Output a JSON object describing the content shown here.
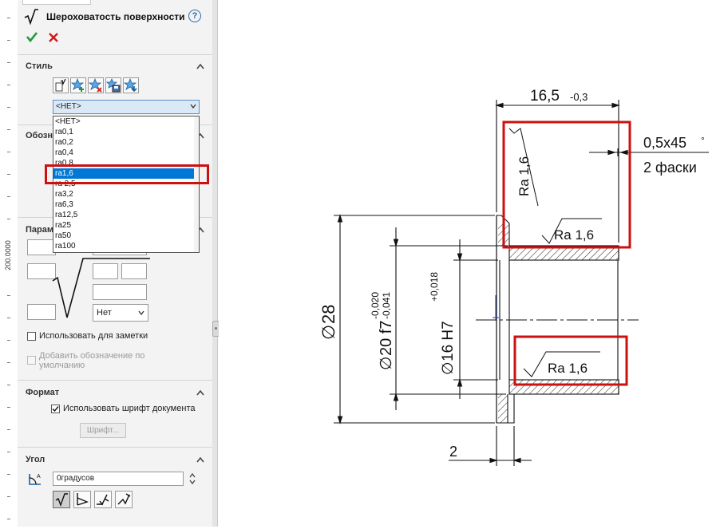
{
  "ruler": {
    "label": "200.0000"
  },
  "panel": {
    "title": "Шероховатость поверхности",
    "help_icon": "question-circle-icon",
    "ok_icon": "green-check-icon",
    "cancel_icon": "red-x-icon",
    "sections": {
      "style": "Стиль",
      "symbol_partial": "Обозн",
      "params_partial": "Парам",
      "format": "Формат",
      "angle": "Угол"
    },
    "style_buttons": [
      "apply-style-icon",
      "add-style-icon",
      "delete-style-icon",
      "save-style-icon",
      "load-style-icon"
    ],
    "style_combo": {
      "value": "<НЕТ>",
      "options": [
        "<НЕТ>",
        "ra0,1",
        "ra0,2",
        "ra0,4",
        "ra0,8",
        "ra1,6",
        "ra 2,5",
        "ra3,2",
        "ra6,3",
        "ra12,5",
        "ra25",
        "ra50",
        "ra100"
      ],
      "selected_index": 5
    },
    "params": {
      "lay_select": "Нет"
    },
    "use_for_note": {
      "label": "Использовать для заметки",
      "checked": false
    },
    "default_symbol": {
      "label": "Добавить обозначение по умолчанию",
      "checked": false,
      "disabled": true
    },
    "format": {
      "use_doc_font": {
        "label": "Использовать шрифт документа",
        "checked": true
      },
      "font_button": "Шрифт..."
    },
    "angle": {
      "value": "0градусов",
      "rotation_buttons": [
        "symbol-upright-icon",
        "symbol-rotate-90-icon",
        "symbol-perpendicular-icon",
        "symbol-rotate-angle-icon"
      ]
    }
  },
  "drawing": {
    "dim_top": "16,5",
    "dim_top_tol": "-0,3",
    "chamfer": "0,5x45",
    "chamfer_deg": "°",
    "chamfer_count": "2 фаски",
    "dim_outer": "28",
    "dim_shaft": "20 f7",
    "dim_shaft_tol_upper": "-0,020",
    "dim_shaft_tol_lower": "-0,041",
    "dim_hole": "16 H7",
    "dim_hole_tol": "+0,018",
    "dim_flange": "2",
    "diameter_sign": "∅",
    "rough_left": "Ra 1,6",
    "rough_top": "Ra 1,6",
    "rough_bottom": "Ra 1,6",
    "highlight_color": "#cc1111"
  }
}
